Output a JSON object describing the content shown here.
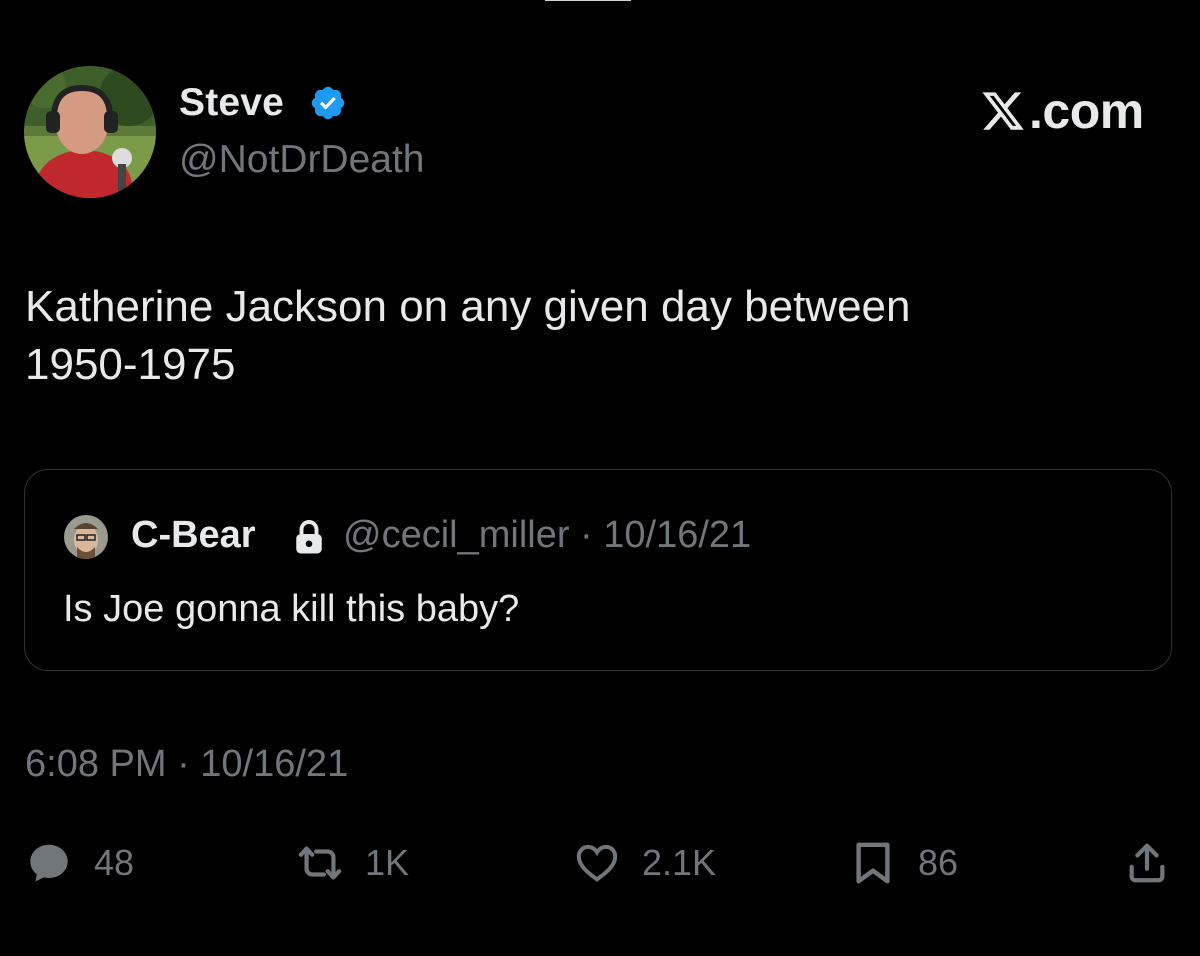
{
  "author": {
    "name": "Steve",
    "handle": "@NotDrDeath",
    "verified": true
  },
  "brand": {
    "suffix": ".com",
    "accent_color": "#1d9bf0"
  },
  "tweet": {
    "line1": "Katherine Jackson on any given day between",
    "line2": "1950-1975",
    "timestamp": "6:08 PM · 10/16/21"
  },
  "quote": {
    "name": "C-Bear",
    "meta": "@cecil_miller · 10/16/21",
    "text": "Is Joe gonna kill this baby?",
    "locked": true
  },
  "actions": {
    "replies": "48",
    "reposts": "1K",
    "likes": "2.1K",
    "bookmarks": "86"
  },
  "icons": [
    "reply-icon",
    "repost-icon",
    "like-icon",
    "bookmark-icon",
    "share-icon",
    "verified-badge-icon",
    "lock-icon",
    "x-logo-icon"
  ]
}
